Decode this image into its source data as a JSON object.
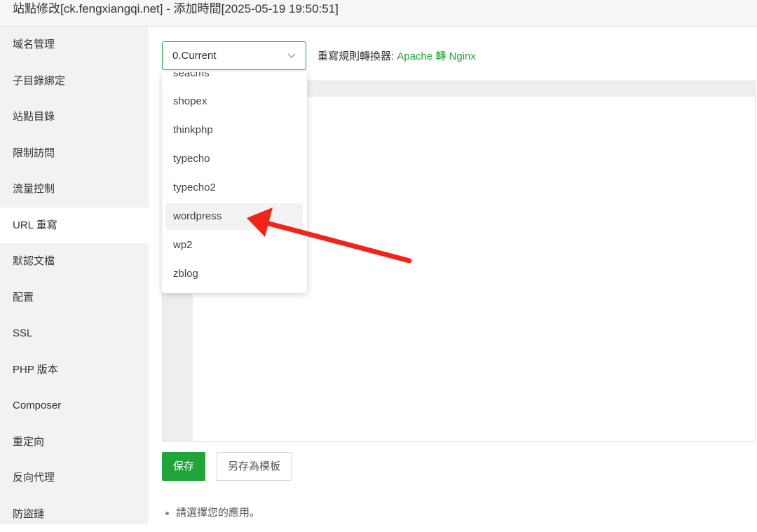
{
  "window": {
    "title": "站點修改[ck.fengxiangqi.net] - 添加時間[2025-05-19 19:50:51]"
  },
  "sidebar": {
    "items": [
      {
        "label": "域名管理"
      },
      {
        "label": "子目錄綁定"
      },
      {
        "label": "站點目錄"
      },
      {
        "label": "限制訪問"
      },
      {
        "label": "流量控制"
      },
      {
        "label": "URL 重寫",
        "active": true
      },
      {
        "label": "默認文檔"
      },
      {
        "label": "配置"
      },
      {
        "label": "SSL"
      },
      {
        "label": "PHP 版本"
      },
      {
        "label": "Composer"
      },
      {
        "label": "重定向"
      },
      {
        "label": "反向代理"
      },
      {
        "label": "防盜鏈"
      }
    ]
  },
  "rewrite": {
    "select_value": "0.Current",
    "converter_label": "重寫規則轉換器:",
    "converter_link": "Apache 轉 Nginx",
    "save_label": "保存",
    "save_template_label": "另存為模板",
    "tip": "請選擇您的應用。"
  },
  "dropdown": {
    "items": [
      {
        "label": "seacms"
      },
      {
        "label": "shopex"
      },
      {
        "label": "thinkphp"
      },
      {
        "label": "typecho"
      },
      {
        "label": "typecho2"
      },
      {
        "label": "wordpress",
        "hover": true
      },
      {
        "label": "wp2"
      },
      {
        "label": "zblog"
      }
    ]
  },
  "colors": {
    "accent": "#20a53a",
    "annotation_arrow": "#f0241b"
  }
}
